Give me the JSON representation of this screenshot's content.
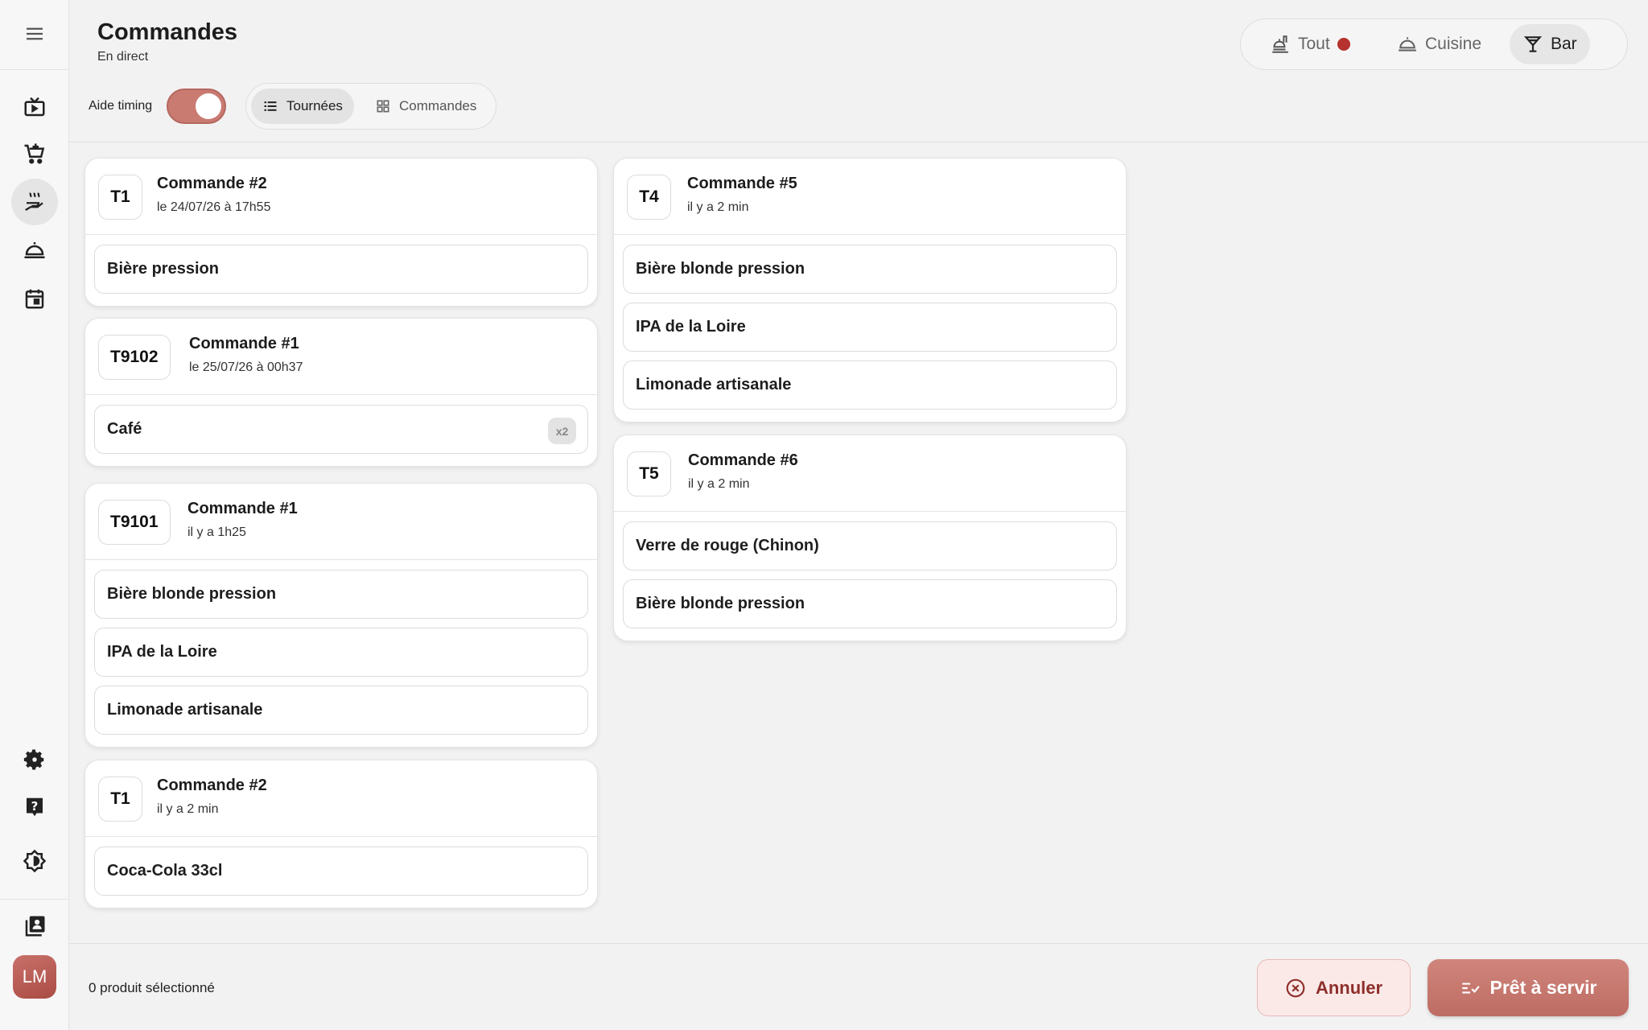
{
  "header": {
    "title": "Commandes",
    "subtitle": "En direct",
    "timing_label": "Aide timing",
    "view_tabs": [
      {
        "label": "Tournées",
        "icon": "list-icon",
        "active": true
      },
      {
        "label": "Commandes",
        "icon": "grid-icon",
        "active": false
      }
    ],
    "filters": [
      {
        "label": "Tout",
        "icon": "dishes-icon",
        "badge": "red-dot",
        "active": false
      },
      {
        "label": "Cuisine",
        "icon": "cloche-icon",
        "active": false
      },
      {
        "label": "Bar",
        "icon": "cocktail-icon",
        "active": true
      }
    ]
  },
  "sidebar": {
    "items": [
      {
        "name": "menu-icon"
      },
      {
        "name": "live-tv-icon"
      },
      {
        "name": "cart-add-icon"
      },
      {
        "name": "cook-hand-icon",
        "active": true
      },
      {
        "name": "cloche-icon"
      },
      {
        "name": "calendar-icon"
      },
      {
        "name": "settings-icon"
      },
      {
        "name": "help-icon"
      },
      {
        "name": "brightness-icon"
      },
      {
        "name": "contacts-book-icon"
      }
    ],
    "avatar_initials": "LM"
  },
  "columns": [
    [
      {
        "table": "T1",
        "title": "Commande #2",
        "time": "le 24/07/26 à 17h55",
        "items": [
          {
            "name": "Bière pression"
          }
        ]
      },
      {
        "table": "T9102",
        "title": "Commande #1",
        "time": "le 25/07/26 à 00h37",
        "items": [
          {
            "name": "Café",
            "qty": "x2"
          }
        ]
      },
      {
        "table": "T9101",
        "title": "Commande #1",
        "time": "il y a 1h25",
        "items": [
          {
            "name": "Bière blonde pression"
          },
          {
            "name": "IPA de la Loire"
          },
          {
            "name": "Limonade artisanale"
          }
        ]
      },
      {
        "table": "T1",
        "title": "Commande #2",
        "time": "il y a 2 min",
        "items": [
          {
            "name": "Coca-Cola 33cl"
          }
        ]
      }
    ],
    [
      {
        "table": "T4",
        "title": "Commande #5",
        "time": "il y a 2 min",
        "items": [
          {
            "name": "Bière blonde pression"
          },
          {
            "name": "IPA de la Loire"
          },
          {
            "name": "Limonade artisanale"
          }
        ]
      },
      {
        "table": "T5",
        "title": "Commande #6",
        "time": "il y a 2 min",
        "items": [
          {
            "name": "Verre de rouge (Chinon)"
          },
          {
            "name": "Bière blonde pression"
          }
        ]
      }
    ]
  ],
  "footer": {
    "selection_text": "0 produit sélectionné",
    "cancel_label": "Annuler",
    "ready_label": "Prêt à servir"
  },
  "colors": {
    "accent": "#c97a71",
    "danger_dot": "#b5322e",
    "cancel_text": "#8e2f2b"
  }
}
